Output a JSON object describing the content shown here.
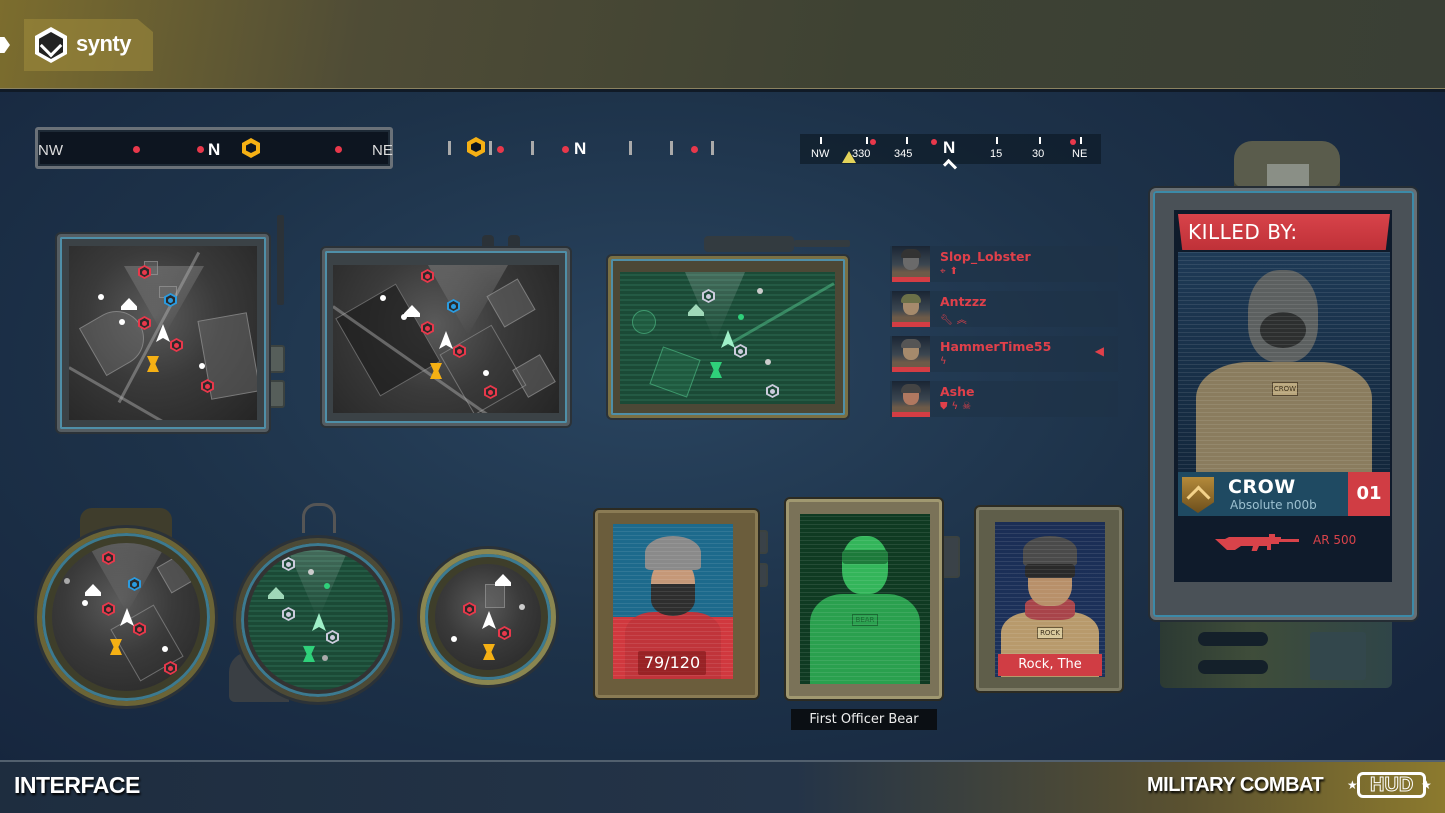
{
  "header": {
    "brand": "synty",
    "brand_icon": "synty-hex-logo-icon"
  },
  "footer": {
    "section_title": "INTERFACE",
    "product_title": "MILITARY COMBAT",
    "product_badge": "HUD"
  },
  "compasses": [
    {
      "style": "framed-bar",
      "labels": [
        "NW",
        "N",
        "NE"
      ],
      "marker": "objective-hex-icon"
    },
    {
      "style": "minimal-ticks",
      "labels": [
        "N"
      ],
      "marker": "objective-hex-icon"
    },
    {
      "style": "degree-strip",
      "labels": [
        "NW",
        "330",
        "345",
        "N",
        "15",
        "30",
        "NE"
      ],
      "heading_marker": "caret-up-icon",
      "waypoint_marker": "yellow-triangle-icon"
    }
  ],
  "minimaps": [
    {
      "style": "square-dark",
      "accessory": "antenna"
    },
    {
      "style": "square-dark-wide",
      "accessory": "twin-knobs"
    },
    {
      "style": "square-green-radar",
      "accessory": "top-handle"
    },
    {
      "style": "round-dark"
    },
    {
      "style": "round-green-radar"
    },
    {
      "style": "round-dark-small"
    }
  ],
  "map_markers": {
    "enemy": "enemy-hex-icon",
    "ally": "ally-hex-icon",
    "player": "player-arrow-icon",
    "base": "base-tent-icon",
    "objective": "objective-hourglass-icon",
    "colors": {
      "enemy": "#e8384b",
      "ally": "#2a9be0",
      "objective": "#f5b014",
      "radar_green": "#2fd07a"
    }
  },
  "squad": [
    {
      "name": "Slop_Lobster",
      "status_icons": [
        "crosshair-icon",
        "boot-up-icon"
      ],
      "speaking": false
    },
    {
      "name": "Antzzz",
      "status_icons": [
        "wrench-icon",
        "rank-chevrons-icon"
      ],
      "speaking": false
    },
    {
      "name": "HammerTime55",
      "status_icons": [
        "lightning-icon"
      ],
      "speaking": true
    },
    {
      "name": "Ashe",
      "status_icons": [
        "shield-icon",
        "lightning-icon",
        "skull-crossbones-icon"
      ],
      "speaking": false
    }
  ],
  "portraits": [
    {
      "style": "health",
      "health_text": "79/120",
      "health_current": 79,
      "health_max": 120
    },
    {
      "style": "hologram-green",
      "caption": "First Officer Bear",
      "vest_tag": "BEAR"
    },
    {
      "style": "named",
      "label": "Rock, The",
      "vest_tag": "ROCK"
    }
  ],
  "killed_by": {
    "title": "KILLED BY:",
    "name": "CROW",
    "subtitle": "Absolute n00b",
    "count": "01",
    "weapon": "AR 500",
    "vest_tag": "CROW",
    "accent": "#d03d44"
  }
}
